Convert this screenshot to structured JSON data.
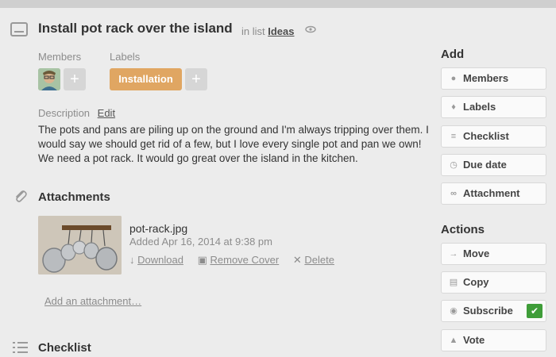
{
  "card": {
    "title": "Install pot rack over the island",
    "in_list_prefix": "in list",
    "list_name": "Ideas"
  },
  "members": {
    "label": "Members",
    "add": "+"
  },
  "labels": {
    "label": "Labels",
    "chip": "Installation",
    "chip_color": "#e0a662",
    "add": "+"
  },
  "description": {
    "label": "Description",
    "edit": "Edit",
    "text": "The pots and pans are piling up on the ground and I'm always tripping over them. I would say we should get rid of a few, but I love every single pot and pan we own! We need a pot rack. It would go great over the island in the kitchen."
  },
  "attachments": {
    "heading": "Attachments",
    "file": {
      "name": "pot-rack.jpg",
      "added": "Added Apr 16, 2014 at 9:38 pm",
      "download": "Download",
      "remove_cover": "Remove Cover",
      "delete": "Delete"
    },
    "add_link": "Add an attachment…"
  },
  "checklist": {
    "heading": "Checklist"
  },
  "sidebar": {
    "add_heading": "Add",
    "add_buttons": [
      {
        "label": "Members",
        "icon": "person-icon"
      },
      {
        "label": "Labels",
        "icon": "tag-icon"
      },
      {
        "label": "Checklist",
        "icon": "list-icon"
      },
      {
        "label": "Due date",
        "icon": "clock-icon"
      },
      {
        "label": "Attachment",
        "icon": "paperclip-icon"
      }
    ],
    "actions_heading": "Actions",
    "action_buttons": [
      {
        "label": "Move",
        "icon": "arrow-right-icon"
      },
      {
        "label": "Copy",
        "icon": "copy-icon"
      },
      {
        "label": "Subscribe",
        "icon": "eye-icon",
        "checked": true
      },
      {
        "label": "Vote",
        "icon": "thumbs-up-icon"
      }
    ]
  },
  "colors": {
    "subscribe_check": "#3f9d39",
    "background": "#ececec"
  }
}
